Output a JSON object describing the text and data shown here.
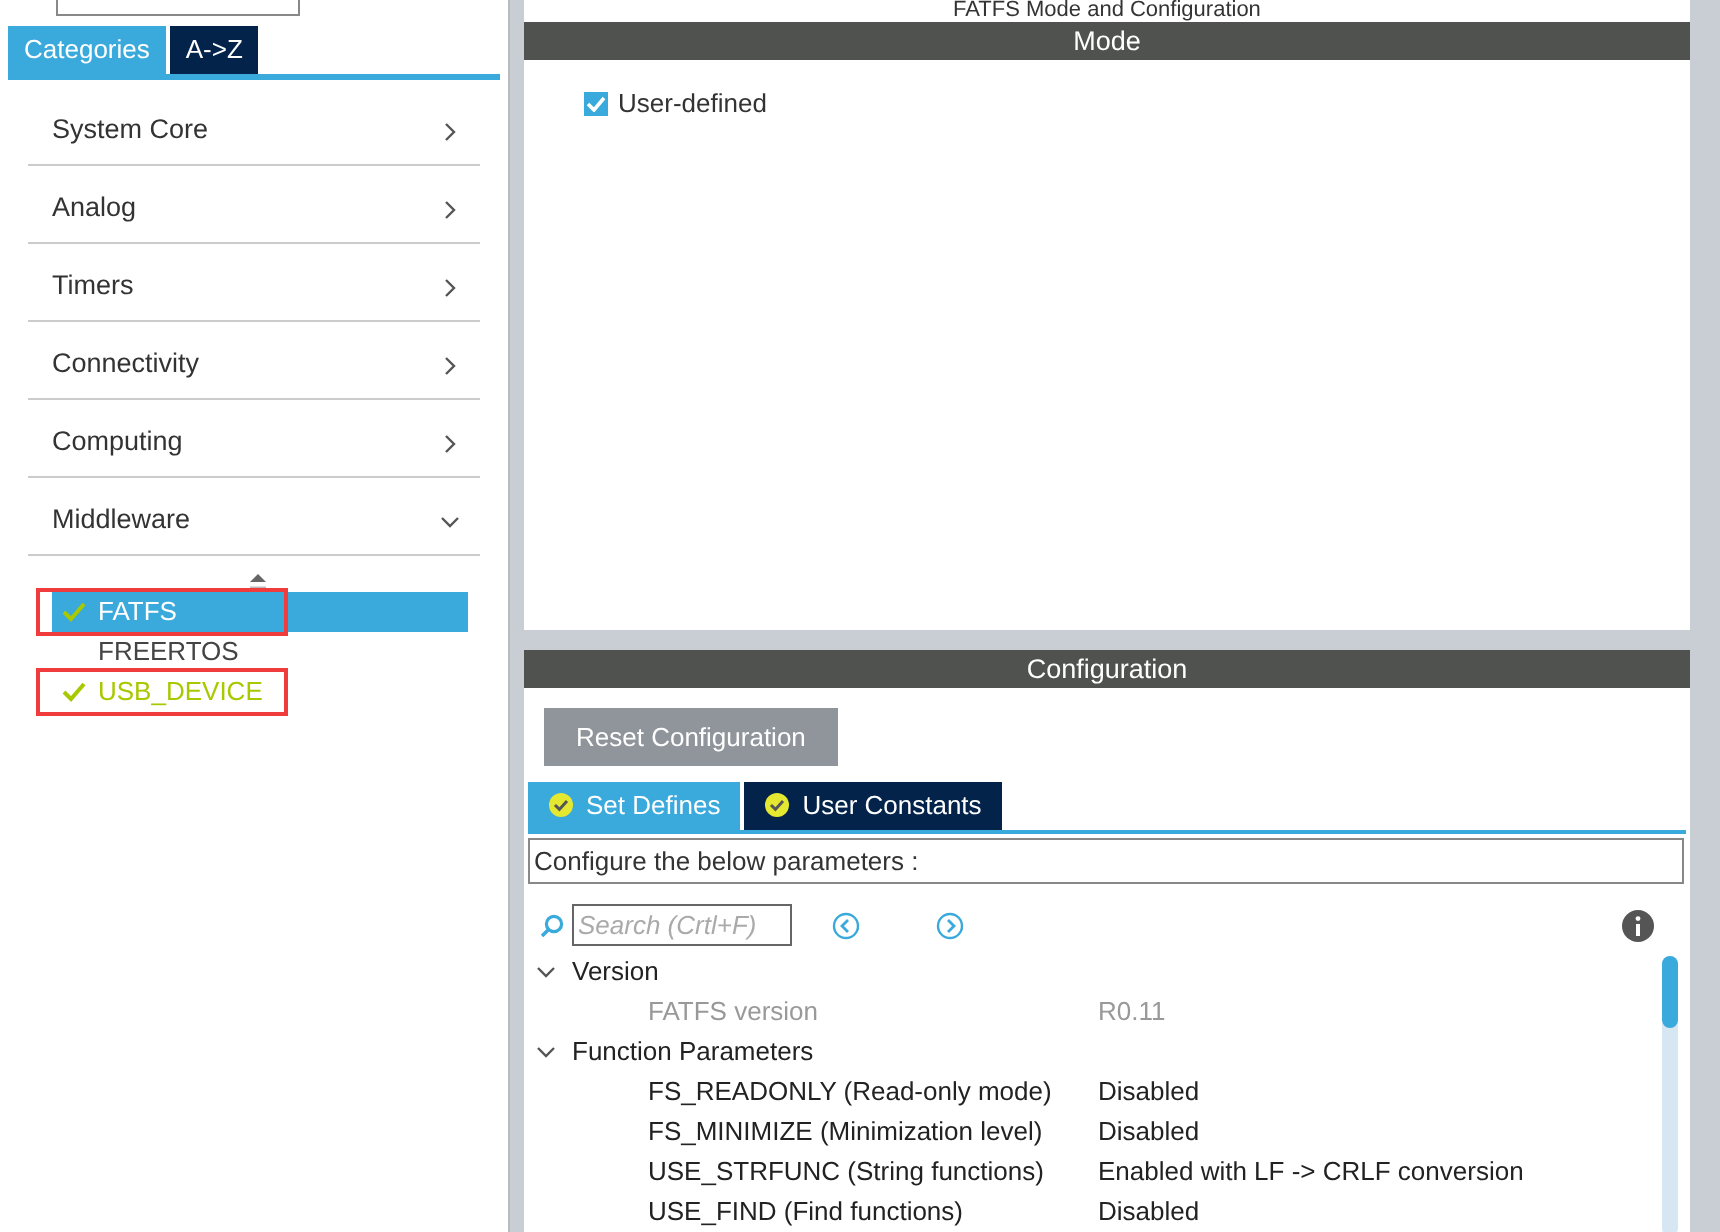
{
  "left_panel": {
    "tabs": [
      {
        "label": "Categories",
        "selected": true
      },
      {
        "label": "A->Z",
        "selected": false
      }
    ],
    "categories": [
      {
        "label": "System Core",
        "expanded": false
      },
      {
        "label": "Analog",
        "expanded": false
      },
      {
        "label": "Timers",
        "expanded": false
      },
      {
        "label": "Connectivity",
        "expanded": false
      },
      {
        "label": "Computing",
        "expanded": false
      },
      {
        "label": "Middleware",
        "expanded": true
      }
    ],
    "middleware_items": [
      {
        "label": "FATFS",
        "selected": true,
        "configured": true,
        "highlighted": true
      },
      {
        "label": "FREERTOS",
        "selected": false,
        "configured": false,
        "highlighted": false
      },
      {
        "label": "USB_DEVICE",
        "selected": false,
        "configured": true,
        "highlighted": true
      }
    ]
  },
  "main": {
    "title": "FATFS Mode and Configuration",
    "mode": {
      "header": "Mode",
      "checkbox": {
        "label": "User-defined",
        "checked": true
      }
    },
    "configuration": {
      "header": "Configuration",
      "reset_button": "Reset Configuration",
      "tabs": [
        {
          "label": "Set Defines",
          "selected": true
        },
        {
          "label": "User Constants",
          "selected": false
        }
      ],
      "description": "Configure the below parameters :",
      "search": {
        "placeholder": "Search (Crtl+F)"
      },
      "tree": [
        {
          "label": "Version",
          "expanded": true,
          "children": [
            {
              "name": "FATFS version",
              "value": "R0.11",
              "disabled": true
            }
          ]
        },
        {
          "label": "Function Parameters",
          "expanded": true,
          "children": [
            {
              "name": "FS_READONLY (Read-only mode)",
              "value": "Disabled",
              "disabled": false
            },
            {
              "name": "FS_MINIMIZE (Minimization level)",
              "value": "Disabled",
              "disabled": false
            },
            {
              "name": "USE_STRFUNC (String functions)",
              "value": "Enabled with LF -> CRLF conversion",
              "disabled": false
            },
            {
              "name": "USE_FIND (Find functions)",
              "value": "Disabled",
              "disabled": false
            }
          ]
        }
      ]
    }
  }
}
